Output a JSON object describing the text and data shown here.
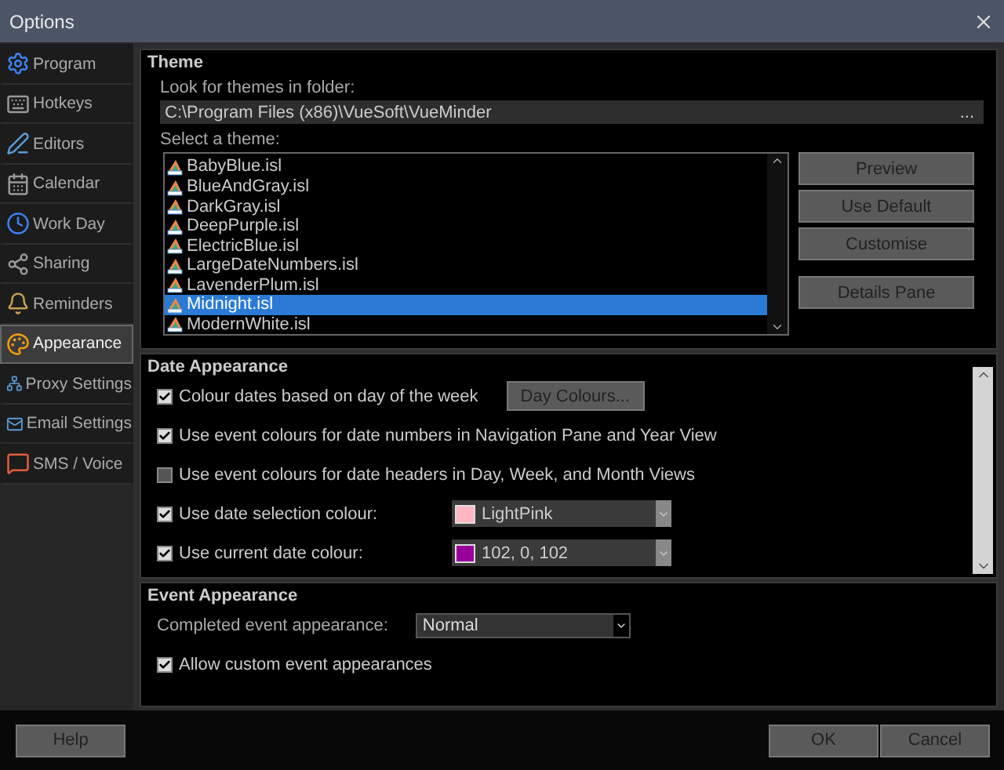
{
  "window": {
    "title": "Options"
  },
  "sidebar": {
    "items": [
      {
        "label": "Program",
        "selected": false
      },
      {
        "label": "Hotkeys",
        "selected": false
      },
      {
        "label": "Editors",
        "selected": false
      },
      {
        "label": "Calendar",
        "selected": false
      },
      {
        "label": "Work Day",
        "selected": false
      },
      {
        "label": "Sharing",
        "selected": false
      },
      {
        "label": "Reminders",
        "selected": false
      },
      {
        "label": "Appearance",
        "selected": true
      },
      {
        "label": "Proxy Settings",
        "selected": false
      },
      {
        "label": "Email Settings",
        "selected": false
      },
      {
        "label": "SMS / Voice",
        "selected": false
      }
    ]
  },
  "theme": {
    "title": "Theme",
    "folder_label": "Look for themes in folder:",
    "folder_value": "C:\\Program Files (x86)\\VueSoft\\VueMinder",
    "browse": "...",
    "select_label": "Select a theme:",
    "themes": [
      {
        "name": "BabyBlue.isl",
        "selected": false
      },
      {
        "name": "BlueAndGray.isl",
        "selected": false
      },
      {
        "name": "DarkGray.isl",
        "selected": false
      },
      {
        "name": "DeepPurple.isl",
        "selected": false
      },
      {
        "name": "ElectricBlue.isl",
        "selected": false
      },
      {
        "name": "LargeDateNumbers.isl",
        "selected": false
      },
      {
        "name": "LavenderPlum.isl",
        "selected": false
      },
      {
        "name": "Midnight.isl",
        "selected": true
      },
      {
        "name": "ModernWhite.isl",
        "selected": false
      }
    ],
    "buttons": [
      "Preview",
      "Use Default",
      "Customise",
      "Details Pane"
    ]
  },
  "date_appearance": {
    "title": "Date Appearance",
    "options": [
      {
        "kind": "button",
        "label": "Colour dates based on day of the week",
        "checked": true,
        "button": "Day Colours..."
      },
      {
        "kind": "plain",
        "label": "Use event colours for date numbers in Navigation Pane and Year View",
        "checked": true
      },
      {
        "kind": "plain",
        "label": "Use event colours for date headers in Day, Week, and Month Views",
        "checked": false
      },
      {
        "kind": "color",
        "label": "Use date selection colour:",
        "checked": true,
        "color": "#ffb6c1",
        "value": "LightPink"
      },
      {
        "kind": "color",
        "label": "Use current date colour:",
        "checked": true,
        "color": "#990099",
        "value": "102, 0, 102"
      }
    ]
  },
  "event_appearance": {
    "title": "Event Appearance",
    "completed_label": "Completed event appearance:",
    "completed_value": "Normal",
    "options": [
      {
        "label": "Allow custom event appearances",
        "checked": true
      }
    ]
  },
  "footer": {
    "help": "Help",
    "ok": "OK",
    "cancel": "Cancel"
  }
}
